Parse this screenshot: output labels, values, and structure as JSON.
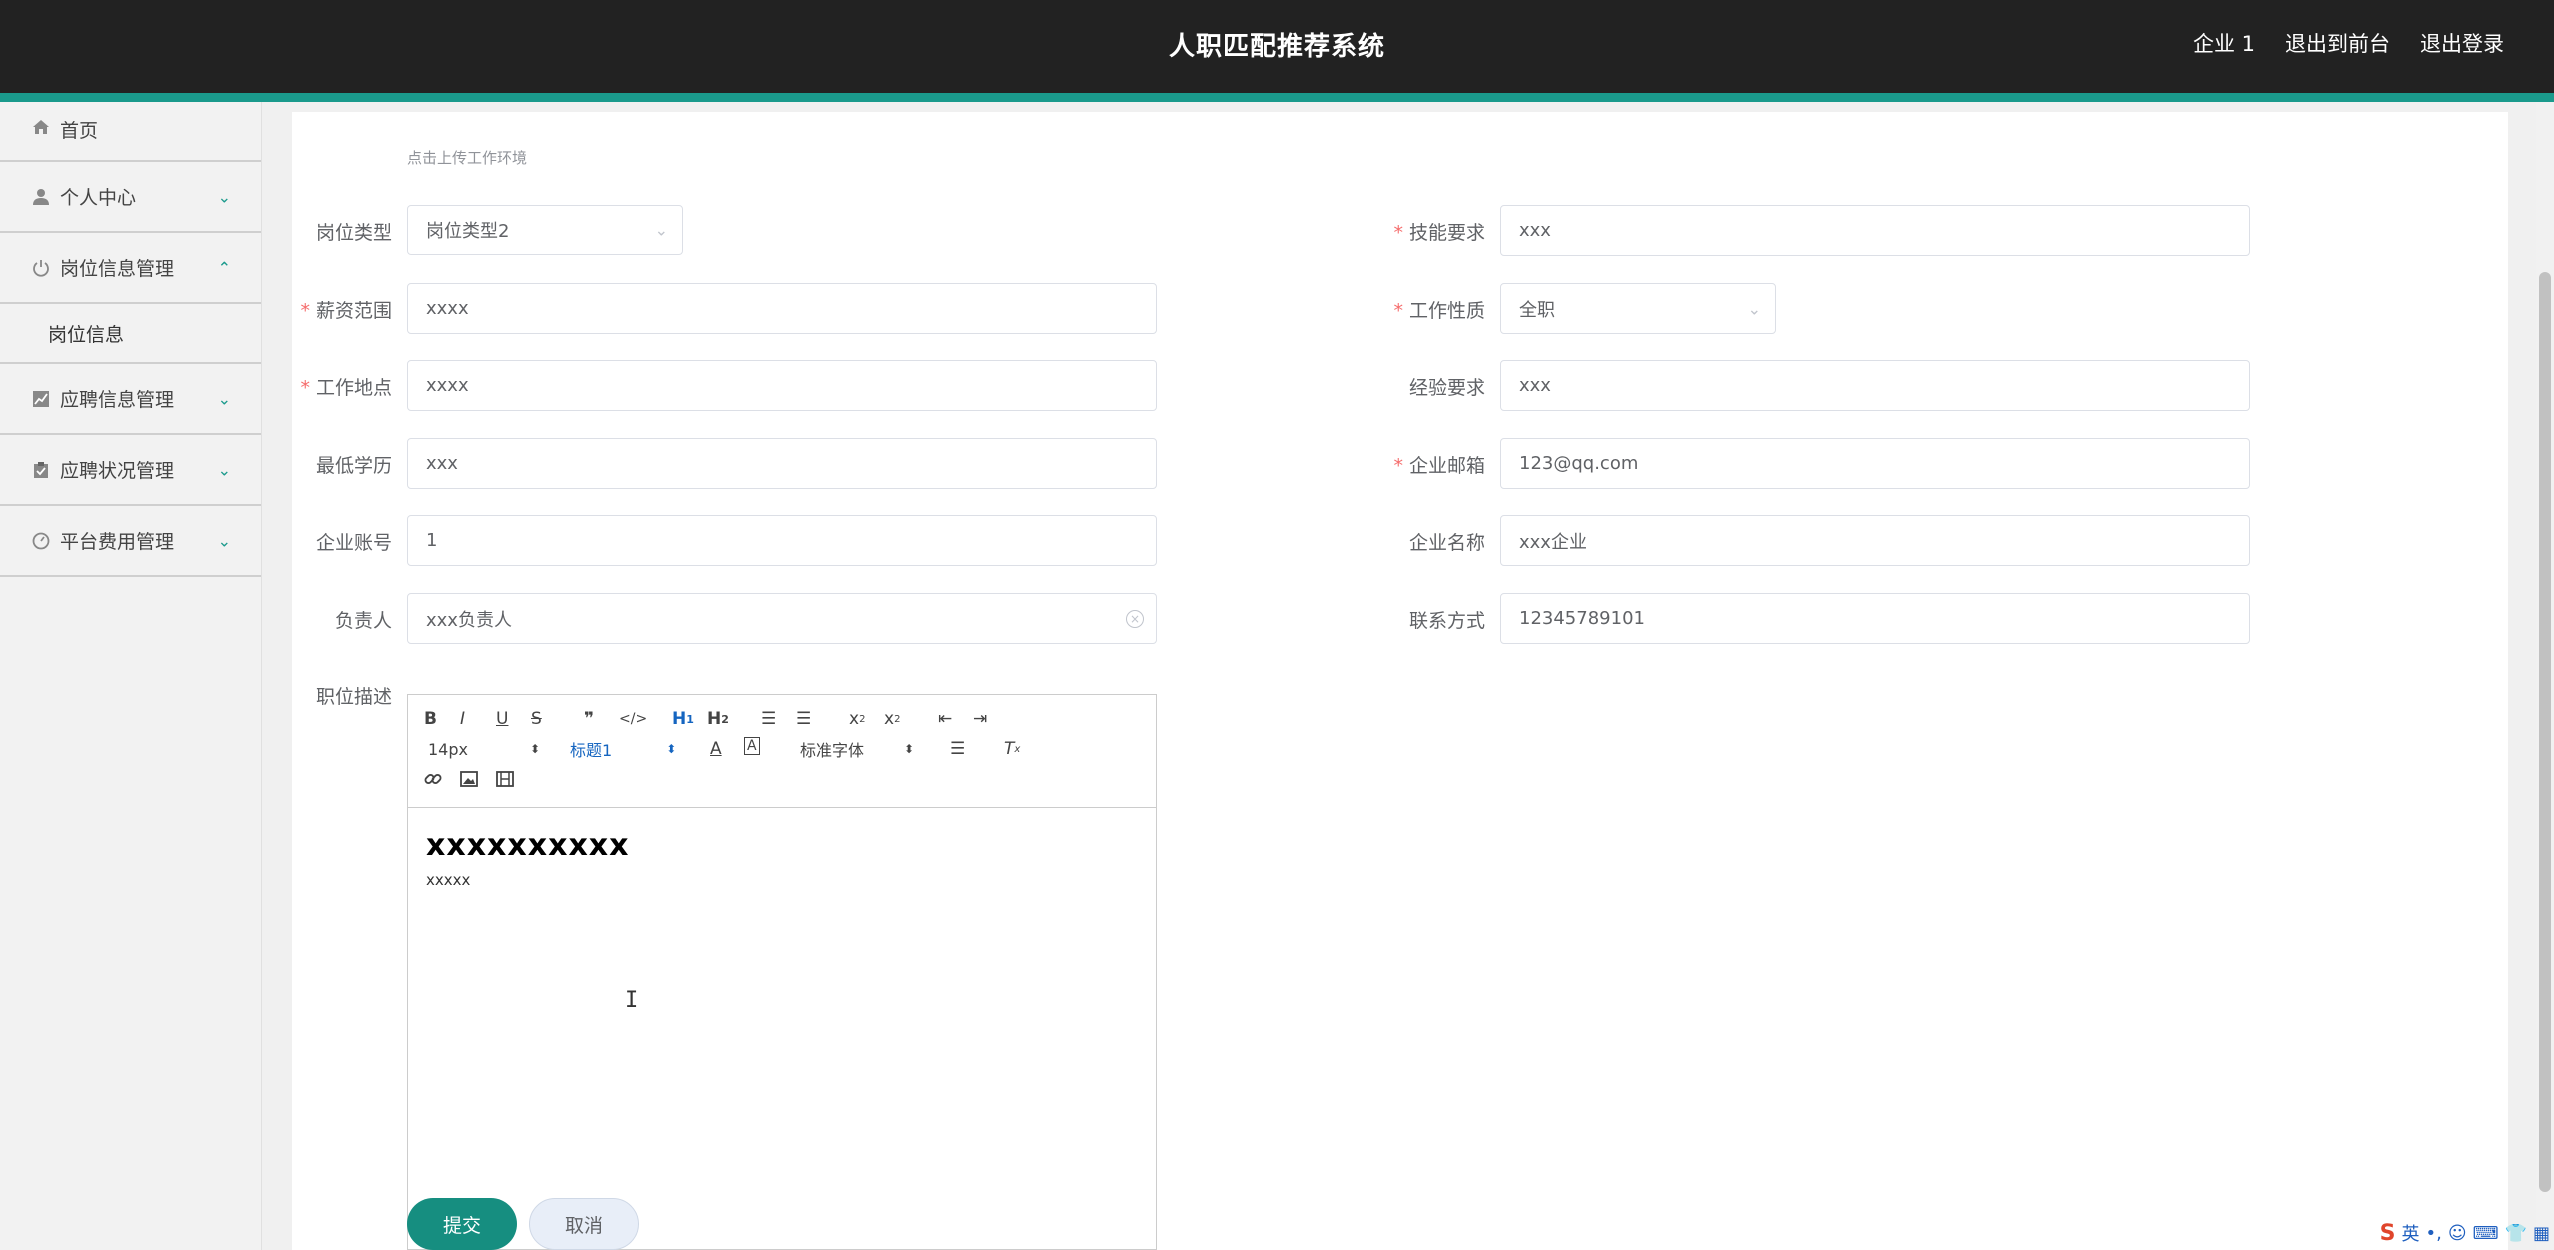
{
  "header": {
    "title": "人职匹配推荐系统",
    "nav": [
      "企业 1",
      "退出到前台",
      "退出登录"
    ]
  },
  "colors": {
    "header_bg": "#222222",
    "accent": "#1a9a8c",
    "submit": "#168e80",
    "required": "#f56c6c"
  },
  "sidebar": {
    "items": [
      {
        "label": "首页",
        "icon": "home-icon"
      },
      {
        "label": "个人中心",
        "icon": "user-icon"
      },
      {
        "label": "岗位信息管理",
        "icon": "power-icon"
      },
      {
        "label": "岗位信息",
        "icon": ""
      },
      {
        "label": "应聘信息管理",
        "icon": "chart-icon"
      },
      {
        "label": "应聘状况管理",
        "icon": "clipboard-icon"
      },
      {
        "label": "平台费用管理",
        "icon": "gauge-icon"
      }
    ]
  },
  "form": {
    "upload_hint": "点击上传工作环境",
    "job_type": {
      "label": "岗位类型",
      "value": "岗位类型2"
    },
    "skill_req": {
      "label": "技能要求",
      "value": "xxx"
    },
    "salary": {
      "label": "薪资范围",
      "value": "xxxx"
    },
    "work_nature": {
      "label": "工作性质",
      "value": "全职"
    },
    "location": {
      "label": "工作地点",
      "value": "xxxx"
    },
    "experience": {
      "label": "经验要求",
      "value": "xxx"
    },
    "education": {
      "label": "最低学历",
      "value": "xxx"
    },
    "email": {
      "label": "企业邮箱",
      "value": "123@qq.com"
    },
    "account": {
      "label": "企业账号",
      "value": "1"
    },
    "company_name": {
      "label": "企业名称",
      "value": "xxx企业"
    },
    "owner": {
      "label": "负责人",
      "value": "xxx负责人"
    },
    "contact": {
      "label": "联系方式",
      "value": "12345789101"
    },
    "description": {
      "label": "职位描述"
    }
  },
  "editor": {
    "font_size": "14px",
    "heading": "标题1",
    "font_family": "标准字体",
    "heading_content": "xxxxxxxxxx",
    "paragraph": "xxxxx"
  },
  "buttons": {
    "submit": "提交",
    "cancel": "取消"
  },
  "ime": {
    "logo": "S",
    "lang": "英"
  }
}
